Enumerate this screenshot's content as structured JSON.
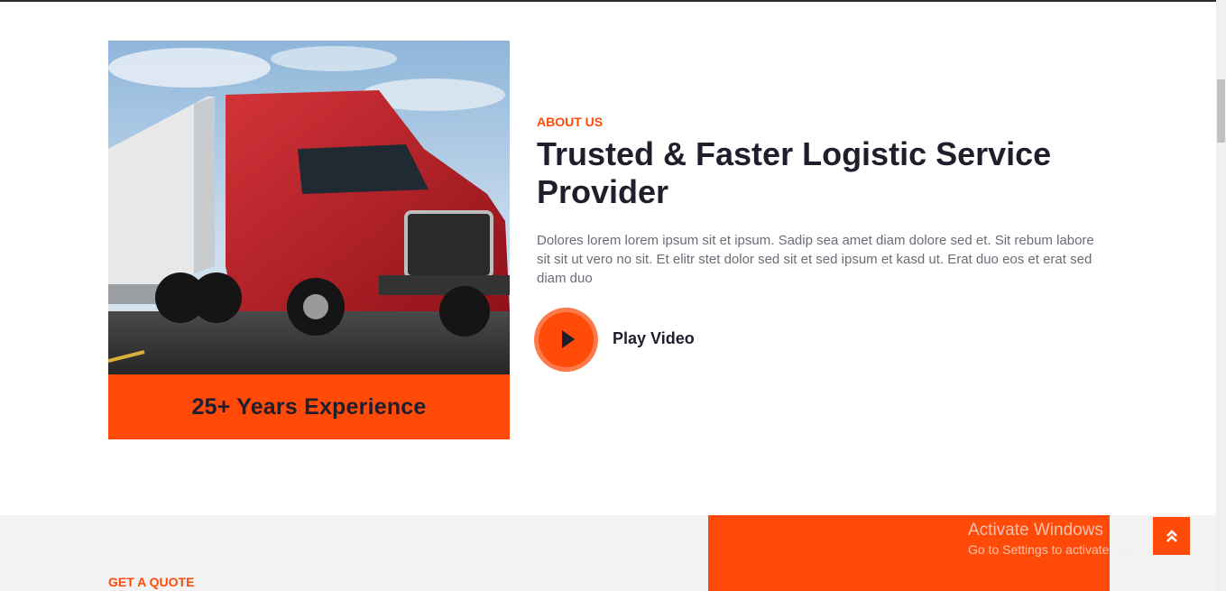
{
  "about": {
    "label": "ABOUT US",
    "title": "Trusted & Faster Logistic Service Provider",
    "body": "Dolores lorem lorem ipsum sit et ipsum. Sadip sea amet diam dolore sed et. Sit rebum labore sit sit ut vero no sit. Et elitr stet dolor sed sit et sed ipsum et kasd ut. Erat duo eos et erat sed diam duo",
    "play_label": "Play Video"
  },
  "experience": {
    "text": "25+ Years Experience"
  },
  "quote": {
    "label": "GET A QUOTE"
  },
  "watermark": {
    "line1": "Activate Windows",
    "line2": "Go to Settings to activate Windows."
  },
  "colors": {
    "accent": "#ff4a08",
    "dark": "#1e1e2d",
    "muted": "#6c6c78",
    "section_bg": "#f2f2f3"
  },
  "icons": {
    "play": "play-icon",
    "back_to_top": "double-chevron-up-icon"
  }
}
